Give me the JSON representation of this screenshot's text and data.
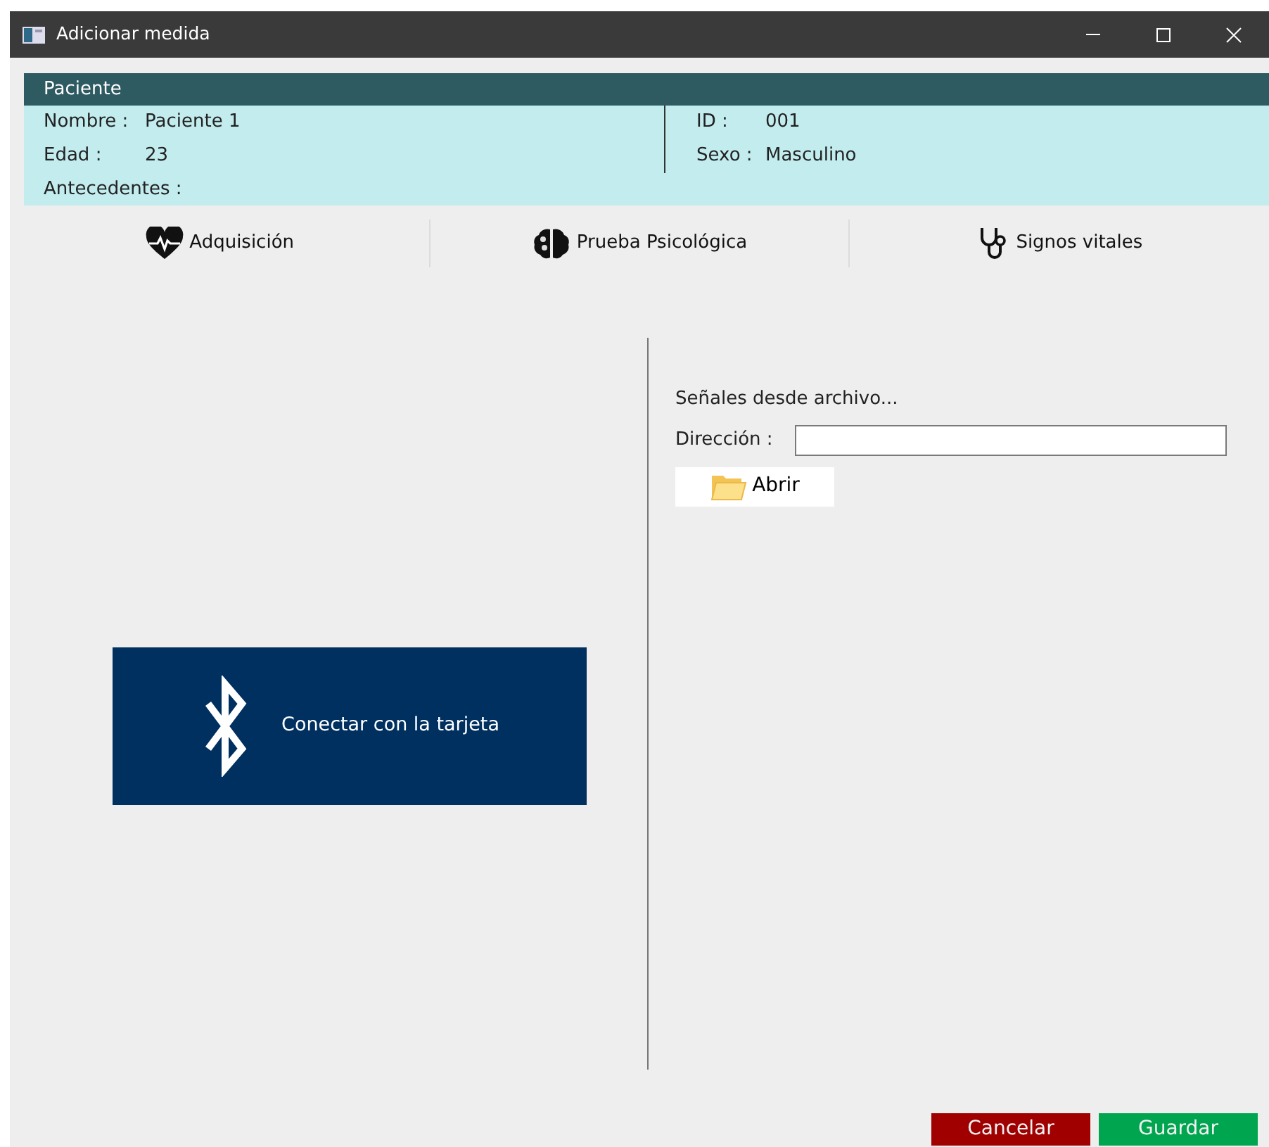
{
  "window": {
    "title": "Adicionar medida"
  },
  "patient": {
    "header": "Paciente",
    "fields": [
      {
        "label": "Nombre :",
        "value": "Paciente 1"
      },
      {
        "label": "Edad :",
        "value": "23"
      },
      {
        "label": "ID :",
        "value": "001"
      },
      {
        "label": "Sexo :",
        "value": "Masculino"
      }
    ],
    "antecedentes_label": "Antecedentes :"
  },
  "tabs": [
    {
      "kind": "heart",
      "label": "Adquisición"
    },
    {
      "kind": "brain",
      "label": "Prueba Psicológica"
    },
    {
      "kind": "stethoscope",
      "label": "Signos vitales"
    }
  ],
  "connect_button": {
    "label": "Conectar con la tarjeta"
  },
  "file_section": {
    "title": "Señales desde archivo...",
    "address_label": "Dirección :",
    "open_button": "Abrir"
  },
  "buttons": [
    {
      "kind": "cancel",
      "label": "Cancelar"
    },
    {
      "kind": "save",
      "label": "Guardar"
    }
  ]
}
